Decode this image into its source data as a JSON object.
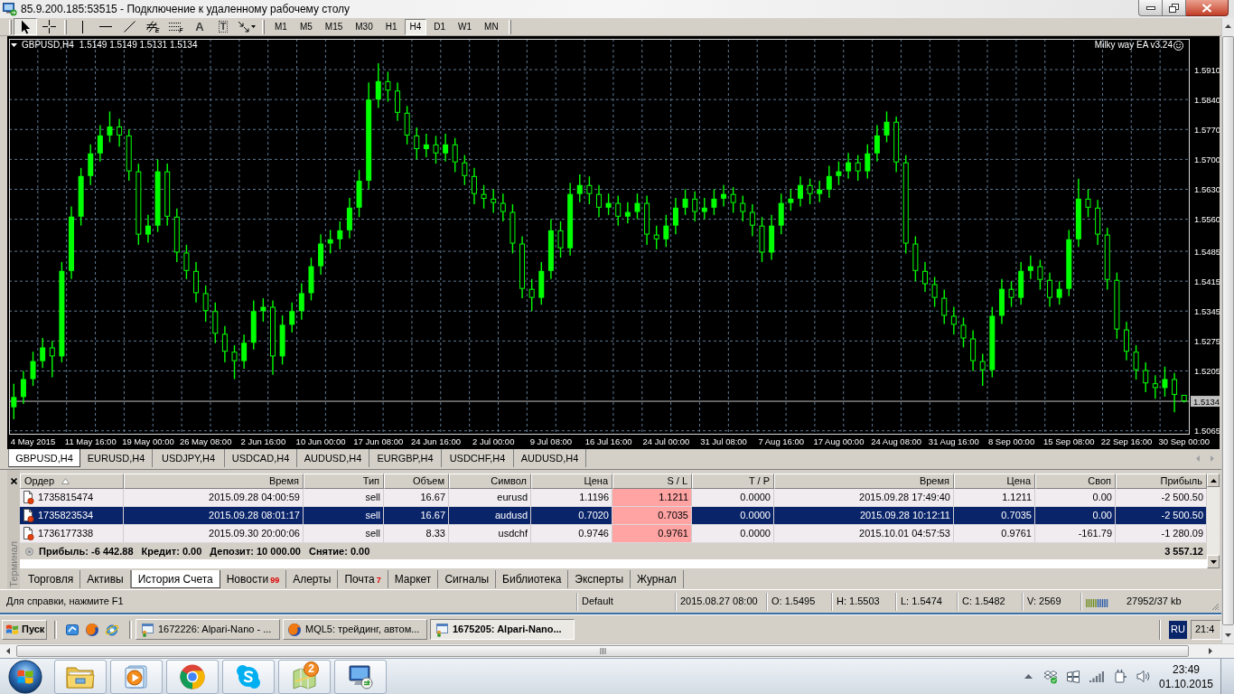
{
  "window": {
    "title": "85.9.200.185:53515 - Подключение к удаленному рабочему столу"
  },
  "toolbar": {
    "tools": [
      {
        "kind": "cursor",
        "selected": true
      },
      {
        "kind": "crosshair",
        "selected": false
      },
      {
        "kind": "vline",
        "selected": false
      },
      {
        "kind": "hline",
        "selected": false
      },
      {
        "kind": "trendline",
        "selected": false
      },
      {
        "kind": "channel",
        "glyph": "E",
        "selected": false
      },
      {
        "kind": "fibo",
        "glyph": "F",
        "selected": false
      },
      {
        "kind": "text",
        "glyph": "A",
        "selected": false
      },
      {
        "kind": "label",
        "glyph": "T",
        "selected": false
      },
      {
        "kind": "arrows",
        "selected": false
      }
    ],
    "timeframes": [
      {
        "label": "M1",
        "selected": false
      },
      {
        "label": "M5",
        "selected": false
      },
      {
        "label": "M15",
        "selected": false
      },
      {
        "label": "M30",
        "selected": false
      },
      {
        "label": "H1",
        "selected": false
      },
      {
        "label": "H4",
        "selected": true
      },
      {
        "label": "D1",
        "selected": false
      },
      {
        "label": "W1",
        "selected": false
      },
      {
        "label": "MN",
        "selected": false
      }
    ]
  },
  "chart": {
    "symbol": "GBPUSD,H4",
    "quote": "1.5149 1.5149 1.5131 1.5134",
    "expert": "Milky way EA v3.24",
    "chart_data": [
      {
        "type": "candlestick",
        "color": "#00ff00",
        "grid": true,
        "ylim": [
          1.5058,
          1.5982
        ],
        "yticks": [
          {
            "value": 1.591,
            "label": "1.5910"
          },
          {
            "value": 1.584,
            "label": "1.5840"
          },
          {
            "value": 1.577,
            "label": "1.5770"
          },
          {
            "value": 1.57,
            "label": "1.5700"
          },
          {
            "value": 1.563,
            "label": "1.5630"
          },
          {
            "value": 1.556,
            "label": "1.5560"
          },
          1.5485,
          1.5415,
          1.5345,
          1.5275,
          1.5205,
          1.5065
        ],
        "ref_lines": [
          {
            "axis": "y",
            "value": 1.5134,
            "label": "1.5134",
            "color": "#c0c0c0"
          }
        ],
        "categories": [
          null,
          null,
          "4 May 2015",
          null,
          null,
          null,
          null,
          null,
          "11 May 16:00",
          null,
          null,
          null,
          null,
          null,
          "19 May 00:00",
          null,
          null,
          null,
          null,
          null,
          "26 May 08:00",
          null,
          null,
          null,
          null,
          null,
          "2 Jun 16:00",
          null,
          null,
          null,
          null,
          null,
          "10 Jun 00:00",
          null,
          null,
          null,
          null,
          null,
          "17 Jun 08:00",
          null,
          null,
          null,
          null,
          null,
          "24 Jun 16:00",
          null,
          null,
          null,
          null,
          null,
          "2 Jul 00:00",
          null,
          null,
          null,
          null,
          null,
          "9 Jul 08:00",
          null,
          null,
          null,
          null,
          null,
          "16 Jul 16:00",
          null,
          null,
          null,
          null,
          null,
          "24 Jul 00:00",
          null,
          null,
          null,
          null,
          null,
          "31 Jul 08:00",
          null,
          null,
          null,
          null,
          null,
          "7 Aug 16:00",
          null,
          null,
          null,
          null,
          null,
          "17 Aug 00:00",
          null,
          null,
          null,
          null,
          null,
          "24 Aug 08:00",
          null,
          null,
          null,
          null,
          null,
          "31 Aug 16:00",
          null,
          null,
          null,
          null,
          null,
          "8 Sep 00:00",
          null,
          null,
          null,
          null,
          null,
          "15 Sep 08:00",
          null,
          null,
          null,
          null,
          null,
          "22 Sep 16:00",
          null,
          null,
          null,
          null,
          null,
          "30 Sep 00:00"
        ],
        "ohlc": [
          [
            1.512,
            1.5175,
            1.5092,
            1.5144
          ],
          [
            1.5144,
            1.5205,
            1.5128,
            1.5186
          ],
          [
            1.5186,
            1.525,
            1.517,
            1.5228
          ],
          [
            1.5228,
            1.5282,
            1.5212,
            1.526
          ],
          [
            1.526,
            1.5275,
            1.519,
            1.5239
          ],
          [
            1.5239,
            1.546,
            1.5225,
            1.5439
          ],
          [
            1.5439,
            1.559,
            1.542,
            1.5566
          ],
          [
            1.5566,
            1.568,
            1.5545,
            1.5661
          ],
          [
            1.5661,
            1.5735,
            1.564,
            1.5714
          ],
          [
            1.5714,
            1.578,
            1.5695,
            1.5756
          ],
          [
            1.5756,
            1.5812,
            1.574,
            1.5777
          ],
          [
            1.5777,
            1.5795,
            1.573,
            1.5756
          ],
          [
            1.5756,
            1.577,
            1.565,
            1.5672
          ],
          [
            1.5672,
            1.569,
            1.55,
            1.5524
          ],
          [
            1.5524,
            1.557,
            1.5505,
            1.5545
          ],
          [
            1.5545,
            1.57,
            1.553,
            1.5672
          ],
          [
            1.5672,
            1.569,
            1.5545,
            1.5566
          ],
          [
            1.5566,
            1.5585,
            1.546,
            1.5482
          ],
          [
            1.5482,
            1.55,
            1.542,
            1.5439
          ],
          [
            1.5439,
            1.546,
            1.5365,
            1.5387
          ],
          [
            1.5387,
            1.5405,
            1.532,
            1.5345
          ],
          [
            1.5345,
            1.5365,
            1.527,
            1.5292
          ],
          [
            1.5292,
            1.531,
            1.5225,
            1.525
          ],
          [
            1.525,
            1.5265,
            1.5186,
            1.5228
          ],
          [
            1.5228,
            1.529,
            1.521,
            1.5271
          ],
          [
            1.5271,
            1.537,
            1.5255,
            1.5345
          ],
          [
            1.5345,
            1.5375,
            1.532,
            1.5355
          ],
          [
            1.5355,
            1.537,
            1.5196,
            1.5239
          ],
          [
            1.5239,
            1.5335,
            1.522,
            1.5313
          ],
          [
            1.5313,
            1.5365,
            1.5295,
            1.5345
          ],
          [
            1.5345,
            1.541,
            1.5325,
            1.5387
          ],
          [
            1.5387,
            1.547,
            1.537,
            1.545
          ],
          [
            1.545,
            1.5525,
            1.543,
            1.5503
          ],
          [
            1.5503,
            1.5535,
            1.548,
            1.5513
          ],
          [
            1.5513,
            1.5555,
            1.549,
            1.5534
          ],
          [
            1.5534,
            1.561,
            1.5515,
            1.5587
          ],
          [
            1.5587,
            1.5675,
            1.5565,
            1.565
          ],
          [
            1.565,
            1.588,
            1.563,
            1.584
          ],
          [
            1.584,
            1.5925,
            1.582,
            1.5883
          ],
          [
            1.5883,
            1.5905,
            1.5835,
            1.5861
          ],
          [
            1.5861,
            1.588,
            1.579,
            1.5809
          ],
          [
            1.5809,
            1.5825,
            1.5735,
            1.5756
          ],
          [
            1.5756,
            1.5775,
            1.57,
            1.5724
          ],
          [
            1.5724,
            1.576,
            1.5705,
            1.5735
          ],
          [
            1.5735,
            1.5755,
            1.569,
            1.5714
          ],
          [
            1.5714,
            1.576,
            1.5695,
            1.5735
          ],
          [
            1.5735,
            1.575,
            1.567,
            1.5693
          ],
          [
            1.5693,
            1.571,
            1.564,
            1.5661
          ],
          [
            1.5661,
            1.568,
            1.5595,
            1.5619
          ],
          [
            1.5619,
            1.564,
            1.5585,
            1.5608
          ],
          [
            1.5608,
            1.563,
            1.5575,
            1.5598
          ],
          [
            1.5598,
            1.562,
            1.5555,
            1.5577
          ],
          [
            1.5577,
            1.5595,
            1.548,
            1.5503
          ],
          [
            1.5503,
            1.552,
            1.5375,
            1.5397
          ],
          [
            1.5397,
            1.542,
            1.5345,
            1.5376
          ],
          [
            1.5376,
            1.546,
            1.536,
            1.5439
          ],
          [
            1.5439,
            1.556,
            1.542,
            1.5534
          ],
          [
            1.5534,
            1.5555,
            1.547,
            1.5492
          ],
          [
            1.5492,
            1.5645,
            1.5475,
            1.5619
          ],
          [
            1.5619,
            1.5665,
            1.56,
            1.564
          ],
          [
            1.564,
            1.566,
            1.5595,
            1.5619
          ],
          [
            1.5619,
            1.564,
            1.5565,
            1.5587
          ],
          [
            1.5587,
            1.562,
            1.557,
            1.5598
          ],
          [
            1.5598,
            1.5615,
            1.5545,
            1.5566
          ],
          [
            1.5566,
            1.56,
            1.555,
            1.5577
          ],
          [
            1.5577,
            1.562,
            1.556,
            1.5598
          ],
          [
            1.5598,
            1.5615,
            1.55,
            1.5524
          ],
          [
            1.5524,
            1.5545,
            1.549,
            1.5513
          ],
          [
            1.5513,
            1.557,
            1.5495,
            1.5545
          ],
          [
            1.5545,
            1.561,
            1.5525,
            1.5587
          ],
          [
            1.5587,
            1.563,
            1.557,
            1.5608
          ],
          [
            1.5608,
            1.5625,
            1.5555,
            1.5577
          ],
          [
            1.5577,
            1.561,
            1.556,
            1.5587
          ],
          [
            1.5587,
            1.563,
            1.557,
            1.5608
          ],
          [
            1.5608,
            1.564,
            1.559,
            1.5619
          ],
          [
            1.5619,
            1.5635,
            1.5575,
            1.5598
          ],
          [
            1.5598,
            1.5615,
            1.5555,
            1.5577
          ],
          [
            1.5577,
            1.5595,
            1.552,
            1.5545
          ],
          [
            1.5545,
            1.5565,
            1.546,
            1.5482
          ],
          [
            1.5482,
            1.557,
            1.5465,
            1.5545
          ],
          [
            1.5545,
            1.562,
            1.5525,
            1.5598
          ],
          [
            1.5598,
            1.563,
            1.558,
            1.5608
          ],
          [
            1.5608,
            1.566,
            1.559,
            1.564
          ],
          [
            1.564,
            1.5655,
            1.5595,
            1.5619
          ],
          [
            1.5619,
            1.565,
            1.56,
            1.5629
          ],
          [
            1.5629,
            1.5685,
            1.561,
            1.5661
          ],
          [
            1.5661,
            1.5695,
            1.564,
            1.5672
          ],
          [
            1.5672,
            1.5715,
            1.5655,
            1.5693
          ],
          [
            1.5693,
            1.571,
            1.565,
            1.5672
          ],
          [
            1.5672,
            1.5735,
            1.5655,
            1.5714
          ],
          [
            1.5714,
            1.578,
            1.5695,
            1.5756
          ],
          [
            1.5756,
            1.5812,
            1.574,
            1.5788
          ],
          [
            1.5788,
            1.58,
            1.567,
            1.5693
          ],
          [
            1.5693,
            1.571,
            1.548,
            1.5503
          ],
          [
            1.5503,
            1.552,
            1.5415,
            1.5439
          ],
          [
            1.5439,
            1.546,
            1.539,
            1.5408
          ],
          [
            1.5408,
            1.5425,
            1.5355,
            1.5376
          ],
          [
            1.5376,
            1.5395,
            1.5315,
            1.5334
          ],
          [
            1.5334,
            1.5355,
            1.529,
            1.5313
          ],
          [
            1.5313,
            1.533,
            1.526,
            1.5281
          ],
          [
            1.5281,
            1.53,
            1.5205,
            1.5228
          ],
          [
            1.5228,
            1.5245,
            1.517,
            1.5207
          ],
          [
            1.5207,
            1.5355,
            1.519,
            1.5334
          ],
          [
            1.5334,
            1.542,
            1.5315,
            1.5397
          ],
          [
            1.5397,
            1.5415,
            1.5355,
            1.5376
          ],
          [
            1.5376,
            1.546,
            1.536,
            1.5439
          ],
          [
            1.5439,
            1.5475,
            1.542,
            1.545
          ],
          [
            1.545,
            1.5465,
            1.5395,
            1.5418
          ],
          [
            1.5418,
            1.5435,
            1.5355,
            1.5376
          ],
          [
            1.5376,
            1.5415,
            1.536,
            1.5397
          ],
          [
            1.5397,
            1.5535,
            1.538,
            1.5513
          ],
          [
            1.5513,
            1.5655,
            1.5495,
            1.5608
          ],
          [
            1.5608,
            1.563,
            1.5565,
            1.5587
          ],
          [
            1.5587,
            1.5605,
            1.55,
            1.5524
          ],
          [
            1.5524,
            1.554,
            1.5395,
            1.5418
          ],
          [
            1.5418,
            1.5435,
            1.528,
            1.5302
          ],
          [
            1.5302,
            1.532,
            1.523,
            1.525
          ],
          [
            1.525,
            1.5265,
            1.5185,
            1.5207
          ],
          [
            1.5207,
            1.5225,
            1.5155,
            1.5176
          ],
          [
            1.5176,
            1.5195,
            1.514,
            1.5165
          ],
          [
            1.5165,
            1.5215,
            1.5145,
            1.5186
          ],
          [
            1.5186,
            1.52,
            1.5108,
            1.5149
          ],
          [
            1.5149,
            1.5149,
            1.5131,
            1.5134
          ]
        ]
      }
    ]
  },
  "chart_tabs": [
    {
      "label": "GBPUSD,H4",
      "selected": true
    },
    {
      "label": "EURUSD,H4",
      "selected": false
    },
    {
      "label": "USDJPY,H4",
      "selected": false
    },
    {
      "label": "USDCAD,H4",
      "selected": false
    },
    {
      "label": "AUDUSD,H4",
      "selected": false
    },
    {
      "label": "EURGBP,H4",
      "selected": false
    },
    {
      "label": "USDCHF,H4",
      "selected": false
    },
    {
      "label": "AUDUSD,H4",
      "selected": false
    }
  ],
  "terminal": {
    "title": "Терминал",
    "columns": [
      {
        "label": "Ордер",
        "sorted": true
      },
      {
        "label": "Время",
        "sorted": false
      },
      {
        "label": "Тип",
        "sorted": false
      },
      {
        "label": "Объем",
        "sorted": false
      },
      {
        "label": "Символ",
        "sorted": false
      },
      {
        "label": "Цена",
        "sorted": false
      },
      {
        "label": "S / L",
        "sorted": false
      },
      {
        "label": "T / P",
        "sorted": false
      },
      {
        "label": "Время",
        "sorted": false
      },
      {
        "label": "Цена",
        "sorted": false
      },
      {
        "label": "Своп",
        "sorted": false
      },
      {
        "label": "Прибыль",
        "sorted": false
      }
    ],
    "rows": [
      {
        "cells": [
          "1735815474",
          "2015.09.28 04:00:59",
          "sell",
          "16.67",
          "eurusd",
          "1.1196",
          "1.1211",
          "0.0000",
          "2015.09.28 17:49:40",
          "1.1211",
          "0.00",
          "-2 500.50"
        ],
        "sl_hit": true,
        "selected": false
      },
      {
        "cells": [
          "1735823534",
          "2015.09.28 08:01:17",
          "sell",
          "16.67",
          "audusd",
          "0.7020",
          "0.7035",
          "0.0000",
          "2015.09.28 10:12:11",
          "0.7035",
          "0.00",
          "-2 500.50"
        ],
        "sl_hit": true,
        "selected": true
      },
      {
        "cells": [
          "1736177338",
          "2015.09.30 20:00:06",
          "sell",
          "8.33",
          "usdchf",
          "0.9746",
          "0.9761",
          "0.0000",
          "2015.10.01 04:57:53",
          "0.9761",
          "-161.79",
          "-1 280.09"
        ],
        "sl_hit": true,
        "selected": false
      }
    ],
    "summary": [
      "Прибыль: -6 442.88",
      "Кредит: 0.00",
      "Депозит: 10 000.00",
      "Снятие: 0.00"
    ],
    "total": "3 557.12",
    "tabs": [
      {
        "label": "Торговля",
        "selected": false
      },
      {
        "label": "Активы",
        "selected": false
      },
      {
        "label": "История Счета",
        "selected": true
      },
      {
        "label": "Новости",
        "badge": "99",
        "selected": false
      },
      {
        "label": "Алерты",
        "selected": false
      },
      {
        "label": "Почта",
        "badge": "7",
        "selected": false
      },
      {
        "label": "Маркет",
        "selected": false
      },
      {
        "label": "Сигналы",
        "selected": false
      },
      {
        "label": "Библиотека",
        "selected": false
      },
      {
        "label": "Эксперты",
        "selected": false
      },
      {
        "label": "Журнал",
        "selected": false
      }
    ]
  },
  "status_bar": {
    "help": "Для справки, нажмите F1",
    "profile": "Default",
    "time": "2015.08.27 08:00",
    "open": "O: 1.5495",
    "high": "H: 1.5503",
    "low": "L: 1.5474",
    "close": "C: 1.5482",
    "volume": "V: 2569",
    "traffic": "27952/37 kb"
  },
  "remote_taskbar": {
    "start": "Пуск",
    "tasks": [
      {
        "kind": "terminal",
        "label": "1672226: Alpari-Nano - ...",
        "selected": false
      },
      {
        "kind": "browser",
        "label": "MQL5: трейдинг, автом...",
        "selected": false
      },
      {
        "kind": "terminal",
        "label": "1675205: Alpari-Nano...",
        "selected": true
      }
    ],
    "language": "RU",
    "clock": "21:4"
  },
  "taskbar": {
    "badge": "2",
    "time": "23:49",
    "date": "01.10.2015"
  }
}
